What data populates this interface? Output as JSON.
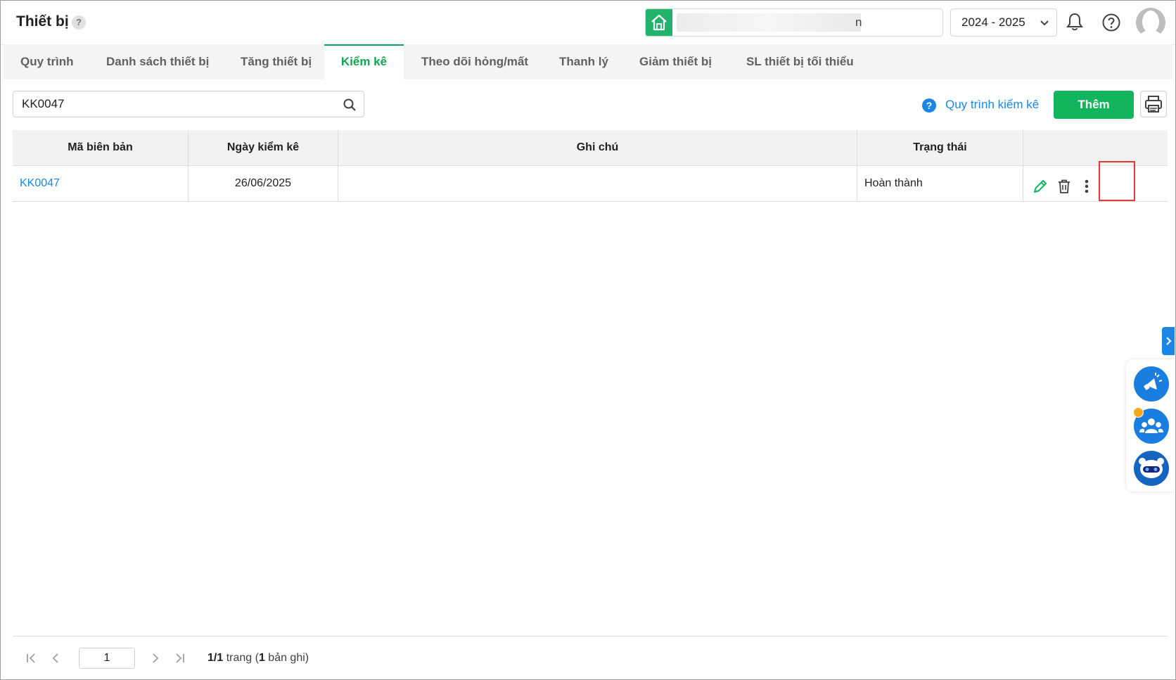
{
  "header": {
    "title": "Thiết bị",
    "help_glyph": "?",
    "school_name_suffix": "n",
    "year": "2024 - 2025"
  },
  "tabs": [
    {
      "label": "Quy trình",
      "active": false
    },
    {
      "label": "Danh sách thiết bị",
      "active": false
    },
    {
      "label": "Tăng thiết bị",
      "active": false
    },
    {
      "label": "Kiểm kê",
      "active": true
    },
    {
      "label": "Theo dõi hỏng/mất",
      "active": false
    },
    {
      "label": "Thanh lý",
      "active": false
    },
    {
      "label": "Giảm thiết bị",
      "active": false
    },
    {
      "label": "SL thiết bị tối thiểu",
      "active": false
    }
  ],
  "toolbar": {
    "search_value": "KK0047",
    "process_link": "Quy trình kiểm kê",
    "add_label": "Thêm"
  },
  "table": {
    "columns": [
      "Mã biên bản",
      "Ngày kiểm kê",
      "Ghi chú",
      "Trạng thái",
      ""
    ],
    "rows": [
      {
        "code": "KK0047",
        "date": "26/06/2025",
        "note": "",
        "status": "Hoàn thành"
      }
    ]
  },
  "pagination": {
    "current_page": "1",
    "pages": "1/1",
    "trang": " trang (",
    "records": "1",
    "suffix": " bản ghi)"
  },
  "colors": {
    "accent_green": "#12b55d",
    "link_blue": "#1a86e6",
    "highlight_red": "#e53935"
  },
  "icons": [
    "home-icon",
    "chevron-down-icon",
    "bell-icon",
    "help-circle-icon",
    "avatar-icon",
    "search-icon",
    "question-icon",
    "printer-icon",
    "pencil-icon",
    "trash-icon",
    "more-vertical-icon",
    "chevron-right-icon",
    "megaphone-icon",
    "community-icon",
    "bot-icon",
    "first-page-icon",
    "prev-page-icon",
    "next-page-icon",
    "last-page-icon"
  ]
}
